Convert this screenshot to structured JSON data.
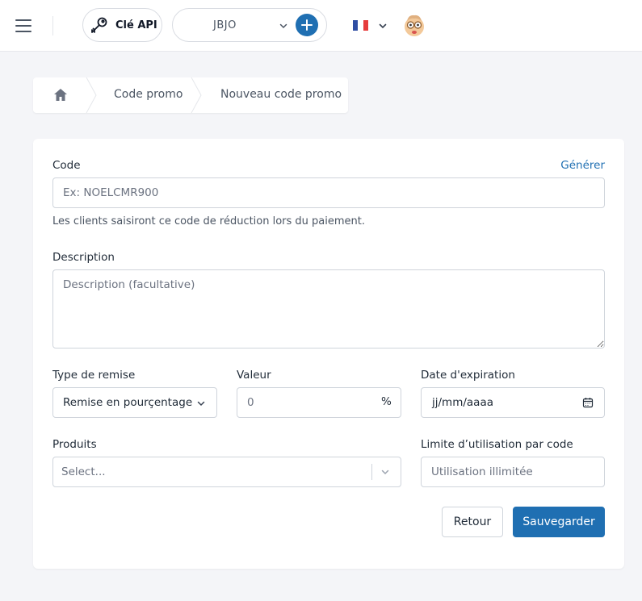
{
  "header": {
    "api_key_label": "Clé API",
    "store_name": "JBJO",
    "language_flag": "FR"
  },
  "breadcrumb": {
    "items": [
      "Code promo",
      "Nouveau code promo"
    ]
  },
  "form": {
    "code": {
      "label": "Code",
      "generate_label": "Générer",
      "placeholder": "Ex: NOELCMR900",
      "help": "Les clients saisiront ce code de réduction lors du paiement."
    },
    "description": {
      "label": "Description",
      "placeholder": "Description (facultative)"
    },
    "discount_type": {
      "label": "Type de remise",
      "value": "Remise en pourçentage"
    },
    "value": {
      "label": "Valeur",
      "placeholder": "0",
      "suffix": "%"
    },
    "expiration": {
      "label": "Date d'expiration",
      "placeholder": "jj/mm/aaaa"
    },
    "products": {
      "label": "Produits",
      "placeholder": "Select..."
    },
    "usage_limit": {
      "label": "Limite d’utilisation par code",
      "placeholder": "Utilisation illimitée"
    },
    "buttons": {
      "back": "Retour",
      "save": "Sauvegarder"
    }
  },
  "colors": {
    "primary": "#1f6fb2",
    "background": "#f4f5f8",
    "flag_blue": "#2f4ea3",
    "flag_red": "#e63c3c"
  }
}
